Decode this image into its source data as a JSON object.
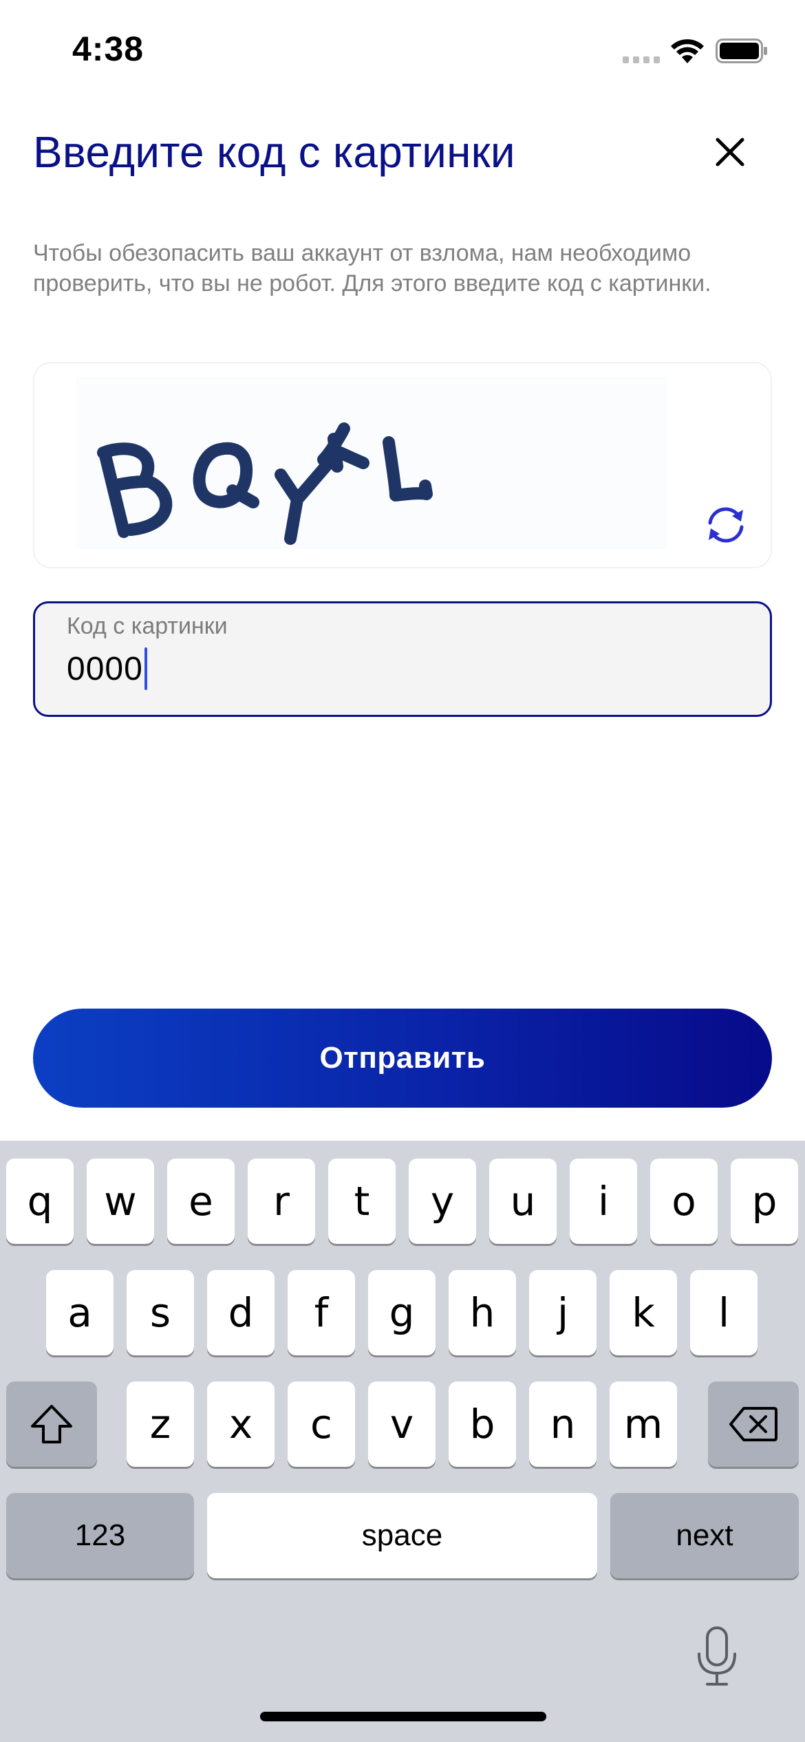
{
  "status_bar": {
    "time": "4:38"
  },
  "header": {
    "title": "Введите код с картинки",
    "close_icon": "close-icon"
  },
  "description": "Чтобы обезопасить ваш аккаунт от взлома, нам необходимо проверить, что вы не робот. Для этого введите код с картинки.",
  "captcha": {
    "refresh_icon": "refresh-icon"
  },
  "code_input": {
    "label": "Код с картинки",
    "value": "0000"
  },
  "submit": {
    "label": "Отправить"
  },
  "keyboard": {
    "row1": [
      "q",
      "w",
      "e",
      "r",
      "t",
      "y",
      "u",
      "i",
      "o",
      "p"
    ],
    "row2": [
      "a",
      "s",
      "d",
      "f",
      "g",
      "h",
      "j",
      "k",
      "l"
    ],
    "row3": [
      "z",
      "x",
      "c",
      "v",
      "b",
      "n",
      "m"
    ],
    "numbers_label": "123",
    "space_label": "space",
    "next_label": "next"
  },
  "colors": {
    "brand": "#0a1188",
    "button_gradient_start": "#0b3fc3",
    "button_gradient_end": "#070b8a",
    "keyboard_bg": "#d1d4da"
  }
}
